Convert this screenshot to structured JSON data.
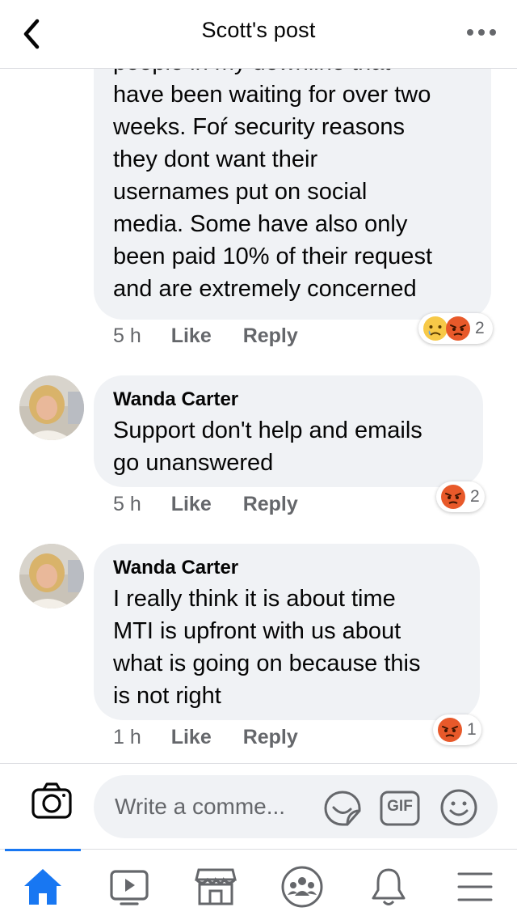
{
  "header": {
    "title": "Scott's post",
    "back_icon": "chevron-left-icon",
    "more_icon": "more-dots-icon"
  },
  "comments": [
    {
      "author": "",
      "lines": [
        "people in my downline that",
        "have been waiting for over two",
        "weeks. Foŕ security reasons",
        "they dont want their",
        "usernames put on social",
        "media. Some have also only",
        "been paid 10% of their request",
        "and are extremely concerned"
      ],
      "time": "5 h",
      "like": "Like",
      "reply": "Reply",
      "reactions": [
        "sad-icon",
        "angry-icon"
      ],
      "reaction_count": "2"
    },
    {
      "author": "Wanda Carter",
      "lines": [
        "Support don't help and emails",
        "go unanswered"
      ],
      "time": "5 h",
      "like": "Like",
      "reply": "Reply",
      "reactions": [
        "angry-icon"
      ],
      "reaction_count": "2"
    },
    {
      "author": "Wanda Carter",
      "lines": [
        "I really think it is about time",
        "MTI is upfront with us about",
        "what is going on because this",
        "is not right"
      ],
      "time": "1 h",
      "like": "Like",
      "reply": "Reply",
      "reactions": [
        "angry-icon"
      ],
      "reaction_count": "1"
    }
  ],
  "composer": {
    "placeholder": "Write a comme...",
    "gif_label": "GIF"
  },
  "tabbar": {
    "items": [
      "home-icon",
      "watch-icon",
      "marketplace-icon",
      "groups-icon",
      "notifications-icon",
      "menu-icon"
    ],
    "active": "home-icon"
  },
  "colors": {
    "accent": "#1877f2",
    "bubble": "#f0f2f5",
    "meta": "#65676b"
  }
}
